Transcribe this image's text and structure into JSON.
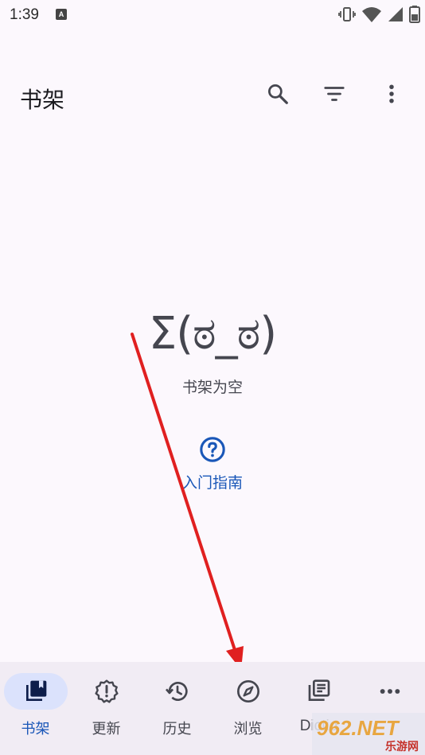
{
  "status_bar": {
    "time": "1:39",
    "notification_glyph": "A",
    "icons": [
      "vibrate-icon",
      "wifi-icon",
      "signal-icon",
      "battery-icon"
    ]
  },
  "app_bar": {
    "title": "书架",
    "actions": [
      "search-icon",
      "filter-icon",
      "more-vert-icon"
    ]
  },
  "empty_state": {
    "kaomoji": "Σ(ಠ_ಠ)",
    "message": "书架为空"
  },
  "guide": {
    "icon": "help-circle-icon",
    "label": "入门指南"
  },
  "bottom_nav": {
    "items": [
      {
        "label": "书架",
        "icon": "library-icon",
        "active": true
      },
      {
        "label": "更新",
        "icon": "alert-badge-icon",
        "active": false
      },
      {
        "label": "历史",
        "icon": "history-icon",
        "active": false
      },
      {
        "label": "浏览",
        "icon": "compass-icon",
        "active": false
      },
      {
        "label": "Dictio",
        "icon": "dictionary-icon",
        "active": false
      },
      {
        "label": "",
        "icon": "more-horiz-icon",
        "active": false
      }
    ]
  },
  "watermark": {
    "text": "962.NET",
    "sub": "乐游网"
  },
  "colors": {
    "background": "#fcf8fd",
    "accent": "#1a57b8",
    "nav_background": "#f1ecf4",
    "active_pill": "#dbe2fc",
    "arrow": "#e02020"
  }
}
